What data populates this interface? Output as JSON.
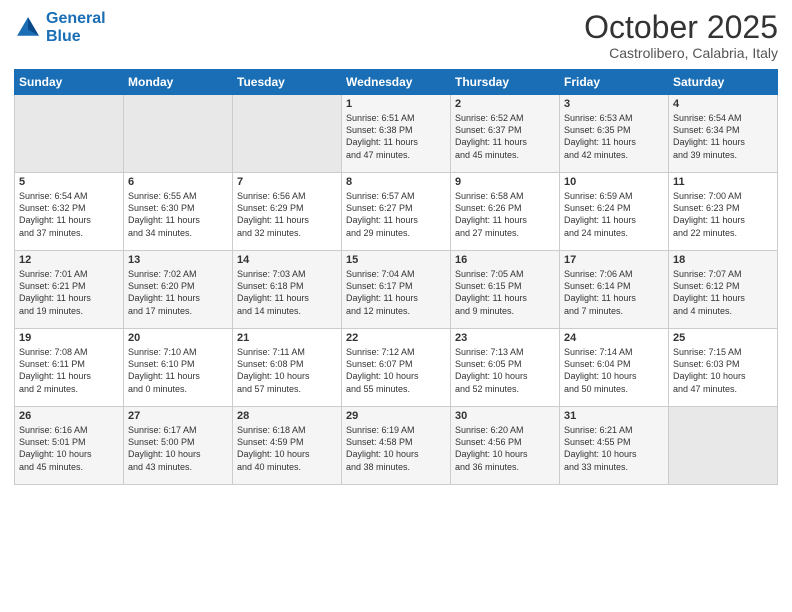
{
  "logo": {
    "line1": "General",
    "line2": "Blue"
  },
  "title": "October 2025",
  "subtitle": "Castrolibero, Calabria, Italy",
  "weekdays": [
    "Sunday",
    "Monday",
    "Tuesday",
    "Wednesday",
    "Thursday",
    "Friday",
    "Saturday"
  ],
  "weeks": [
    [
      {
        "day": "",
        "content": ""
      },
      {
        "day": "",
        "content": ""
      },
      {
        "day": "",
        "content": ""
      },
      {
        "day": "1",
        "content": "Sunrise: 6:51 AM\nSunset: 6:38 PM\nDaylight: 11 hours\nand 47 minutes."
      },
      {
        "day": "2",
        "content": "Sunrise: 6:52 AM\nSunset: 6:37 PM\nDaylight: 11 hours\nand 45 minutes."
      },
      {
        "day": "3",
        "content": "Sunrise: 6:53 AM\nSunset: 6:35 PM\nDaylight: 11 hours\nand 42 minutes."
      },
      {
        "day": "4",
        "content": "Sunrise: 6:54 AM\nSunset: 6:34 PM\nDaylight: 11 hours\nand 39 minutes."
      }
    ],
    [
      {
        "day": "5",
        "content": "Sunrise: 6:54 AM\nSunset: 6:32 PM\nDaylight: 11 hours\nand 37 minutes."
      },
      {
        "day": "6",
        "content": "Sunrise: 6:55 AM\nSunset: 6:30 PM\nDaylight: 11 hours\nand 34 minutes."
      },
      {
        "day": "7",
        "content": "Sunrise: 6:56 AM\nSunset: 6:29 PM\nDaylight: 11 hours\nand 32 minutes."
      },
      {
        "day": "8",
        "content": "Sunrise: 6:57 AM\nSunset: 6:27 PM\nDaylight: 11 hours\nand 29 minutes."
      },
      {
        "day": "9",
        "content": "Sunrise: 6:58 AM\nSunset: 6:26 PM\nDaylight: 11 hours\nand 27 minutes."
      },
      {
        "day": "10",
        "content": "Sunrise: 6:59 AM\nSunset: 6:24 PM\nDaylight: 11 hours\nand 24 minutes."
      },
      {
        "day": "11",
        "content": "Sunrise: 7:00 AM\nSunset: 6:23 PM\nDaylight: 11 hours\nand 22 minutes."
      }
    ],
    [
      {
        "day": "12",
        "content": "Sunrise: 7:01 AM\nSunset: 6:21 PM\nDaylight: 11 hours\nand 19 minutes."
      },
      {
        "day": "13",
        "content": "Sunrise: 7:02 AM\nSunset: 6:20 PM\nDaylight: 11 hours\nand 17 minutes."
      },
      {
        "day": "14",
        "content": "Sunrise: 7:03 AM\nSunset: 6:18 PM\nDaylight: 11 hours\nand 14 minutes."
      },
      {
        "day": "15",
        "content": "Sunrise: 7:04 AM\nSunset: 6:17 PM\nDaylight: 11 hours\nand 12 minutes."
      },
      {
        "day": "16",
        "content": "Sunrise: 7:05 AM\nSunset: 6:15 PM\nDaylight: 11 hours\nand 9 minutes."
      },
      {
        "day": "17",
        "content": "Sunrise: 7:06 AM\nSunset: 6:14 PM\nDaylight: 11 hours\nand 7 minutes."
      },
      {
        "day": "18",
        "content": "Sunrise: 7:07 AM\nSunset: 6:12 PM\nDaylight: 11 hours\nand 4 minutes."
      }
    ],
    [
      {
        "day": "19",
        "content": "Sunrise: 7:08 AM\nSunset: 6:11 PM\nDaylight: 11 hours\nand 2 minutes."
      },
      {
        "day": "20",
        "content": "Sunrise: 7:10 AM\nSunset: 6:10 PM\nDaylight: 11 hours\nand 0 minutes."
      },
      {
        "day": "21",
        "content": "Sunrise: 7:11 AM\nSunset: 6:08 PM\nDaylight: 10 hours\nand 57 minutes."
      },
      {
        "day": "22",
        "content": "Sunrise: 7:12 AM\nSunset: 6:07 PM\nDaylight: 10 hours\nand 55 minutes."
      },
      {
        "day": "23",
        "content": "Sunrise: 7:13 AM\nSunset: 6:05 PM\nDaylight: 10 hours\nand 52 minutes."
      },
      {
        "day": "24",
        "content": "Sunrise: 7:14 AM\nSunset: 6:04 PM\nDaylight: 10 hours\nand 50 minutes."
      },
      {
        "day": "25",
        "content": "Sunrise: 7:15 AM\nSunset: 6:03 PM\nDaylight: 10 hours\nand 47 minutes."
      }
    ],
    [
      {
        "day": "26",
        "content": "Sunrise: 6:16 AM\nSunset: 5:01 PM\nDaylight: 10 hours\nand 45 minutes."
      },
      {
        "day": "27",
        "content": "Sunrise: 6:17 AM\nSunset: 5:00 PM\nDaylight: 10 hours\nand 43 minutes."
      },
      {
        "day": "28",
        "content": "Sunrise: 6:18 AM\nSunset: 4:59 PM\nDaylight: 10 hours\nand 40 minutes."
      },
      {
        "day": "29",
        "content": "Sunrise: 6:19 AM\nSunset: 4:58 PM\nDaylight: 10 hours\nand 38 minutes."
      },
      {
        "day": "30",
        "content": "Sunrise: 6:20 AM\nSunset: 4:56 PM\nDaylight: 10 hours\nand 36 minutes."
      },
      {
        "day": "31",
        "content": "Sunrise: 6:21 AM\nSunset: 4:55 PM\nDaylight: 10 hours\nand 33 minutes."
      },
      {
        "day": "",
        "content": ""
      }
    ]
  ]
}
